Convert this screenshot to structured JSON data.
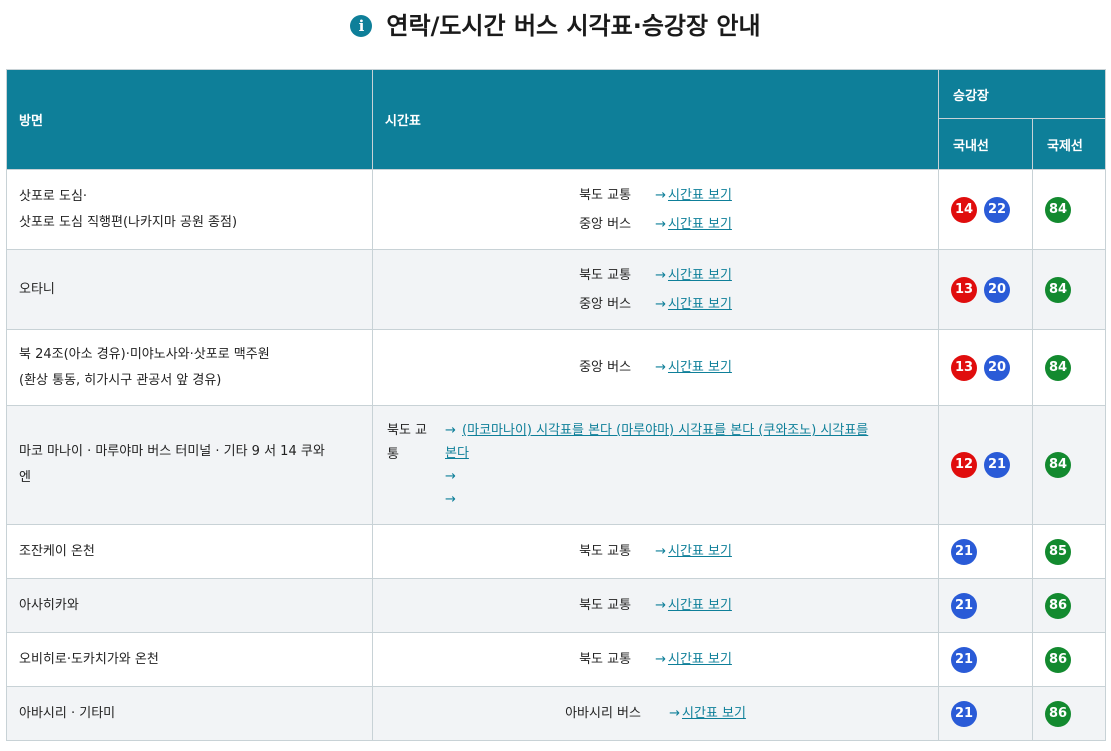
{
  "title": "연락/도시간 버스 시각표·승강장 안내",
  "header": {
    "direction": "방면",
    "timetable": "시간표",
    "platform": "승강장",
    "domestic": "국내선",
    "international": "국제선"
  },
  "link_text": "시간표 보기",
  "arrow": "→",
  "rows": [
    {
      "dir1": "삿포로 도심·",
      "dir2": "삿포로 도심 직행편(나카지마 공원 종점)",
      "op1": "북도 교통",
      "op2": "중앙 버스",
      "dom1": "14",
      "dom2": "22",
      "intl": "84"
    },
    {
      "dir1": "오타니",
      "op1": "북도 교통",
      "op2": "중앙 버스",
      "dom1": "13",
      "dom2": "20",
      "intl": "84"
    },
    {
      "dir1": "북 24조(아소 경유)·미야노사와·삿포로 맥주원",
      "dir2": "(환상 통동, 히가시구 관공서 앞 경유)",
      "op1": "중앙 버스",
      "dom1": "13",
      "dom2": "20",
      "intl": "84"
    },
    {
      "dir1": "마코 마나이 · 마루야마 버스 터미널 · 기타 9 서 14 쿠와",
      "dir2": "엔",
      "op1": "북도 교",
      "op1b": "통",
      "links": "(마코마나이) 시각표를 본다 (마루야마) 시각표를 본다 (쿠와조노) 시각표를",
      "links2": "본다",
      "dom1": "12",
      "dom2": "21",
      "intl": "84"
    },
    {
      "dir1": "조잔케이 온천",
      "op1": "북도 교통",
      "dom1": "21",
      "intl": "85"
    },
    {
      "dir1": "아사히카와",
      "op1": "북도 교통",
      "dom1": "21",
      "intl": "86"
    },
    {
      "dir1": "오비히로·도카치가와 온천",
      "op1": "북도 교통",
      "dom1": "21",
      "intl": "86"
    },
    {
      "dir1": "아바시리 · 기타미",
      "op1": "아바시리 버스",
      "dom1": "21",
      "intl": "86"
    }
  ],
  "colors": {
    "header_bg": "#0e7f99",
    "red": "#e00d0d",
    "blue": "#2a5bd7",
    "green": "#138a2f"
  },
  "icons": {
    "title_icon": "info-icon"
  }
}
